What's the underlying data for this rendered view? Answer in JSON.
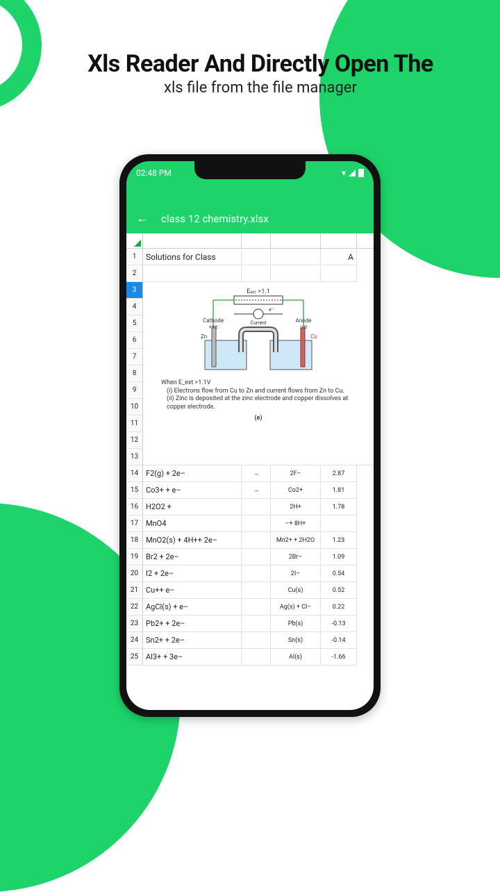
{
  "hero": {
    "title": "Xls Reader And Directly Open The",
    "subtitle": "xls file from the file manager"
  },
  "status": {
    "time": "02:48 PM"
  },
  "appbar": {
    "filename": "class 12 chemistry.xlsx"
  },
  "sheet": {
    "header": {
      "a": "Solutions for Class",
      "b_right": "A"
    },
    "diagram": {
      "top_label": "E_ext >1.1",
      "cathode": "Cathode",
      "cathode_sign": "+ve",
      "anode": "Anode",
      "anode_sign": "-ve",
      "current": "Current",
      "e_minus": "e-",
      "zn": "Zn",
      "cu": "Cu",
      "note_head": "When E_ext >1.1V",
      "note_i": "(i) Electrons flow from Cu to Zn and current flows from Zn to Cu.",
      "note_ii": "(ii) Zinc is deposited at the zinc electrode and copper dissolves at copper electrode.",
      "label_e": "(e)"
    },
    "rows": [
      {
        "n": 14,
        "a": "F2(g) + 2e–",
        "arr": "→",
        "c": "2F–",
        "d": "2.87"
      },
      {
        "n": 15,
        "a": "Co3+ + e–",
        "arr": "→",
        "c": "Co2+",
        "d": "1.81"
      },
      {
        "n": 16,
        "a": "H2O2 +",
        "arr": "",
        "c": "2H+",
        "d": "1.78"
      },
      {
        "n": 17,
        "a": "MnO4",
        "arr": "",
        "c": "–+ 8H+",
        "d": ""
      },
      {
        "n": 18,
        "a": "MnO2(s) + 4H++ 2e–",
        "arr": "",
        "c": "Mn2+ + 2H2O",
        "d": "1.23"
      },
      {
        "n": 19,
        "a": "Br2 + 2e–",
        "arr": "",
        "c": "2Br–",
        "d": "1.09"
      },
      {
        "n": 20,
        "a": "I2 + 2e–",
        "arr": "",
        "c": "2I–",
        "d": "0.54"
      },
      {
        "n": 21,
        "a": "Cu++ e–",
        "arr": "",
        "c": "Cu(s)",
        "d": "0.52"
      },
      {
        "n": 22,
        "a": "AgCl(s) + e–",
        "arr": "",
        "c": "Ag(s) + Cl–",
        "d": "0.22"
      },
      {
        "n": 23,
        "a": "Pb2+ + 2e–",
        "arr": "",
        "c": "Pb(s)",
        "d": "-0.13"
      },
      {
        "n": 24,
        "a": "Sn2+ + 2e–",
        "arr": "",
        "c": "Sn(s)",
        "d": "-0.14"
      },
      {
        "n": 25,
        "a": "Al3+ + 3e–",
        "arr": "",
        "c": "Al(s)",
        "d": "-1.66"
      }
    ]
  }
}
